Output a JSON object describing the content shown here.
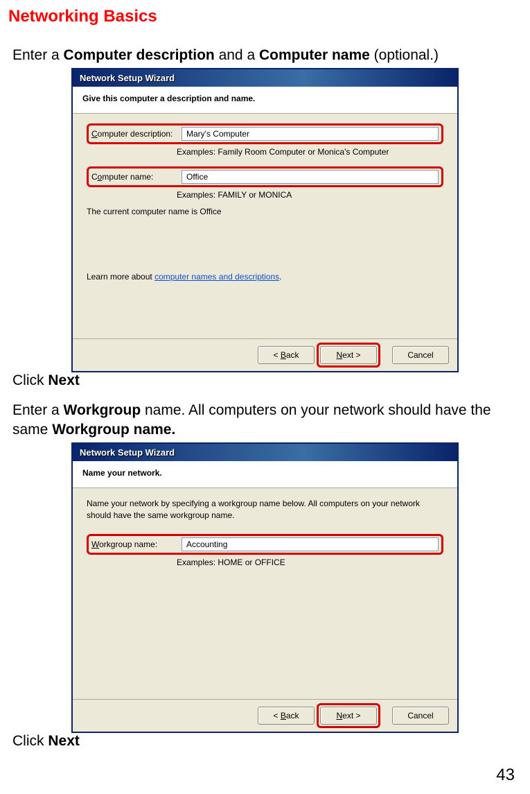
{
  "page": {
    "title": "Networking Basics",
    "page_number": "43"
  },
  "instr1": {
    "pre": "Enter a ",
    "b1": "Computer description",
    "mid": " and a ",
    "b2": "Computer name",
    "post": " (optional.)"
  },
  "wizard1": {
    "title": "Network Setup Wizard",
    "header": "Give this computer a description and name.",
    "desc_label_pre": "C",
    "desc_label_rest": "omputer description:",
    "desc_value": "Mary's Computer",
    "desc_hint": "Examples: Family Room Computer or Monica's Computer",
    "name_label_pre": "o",
    "name_label_prefix": "C",
    "name_label_rest": "mputer name:",
    "name_value": "Office",
    "name_hint": "Examples: FAMILY or MONICA",
    "current_pre": "The current computer name is   ",
    "current_val": "Office",
    "learn_pre": "Learn more about ",
    "learn_link": "computer names and descriptions",
    "btn_back": "< Back",
    "btn_next": "Next >",
    "btn_cancel": "Cancel"
  },
  "click1": {
    "pre": "Click ",
    "b": "Next"
  },
  "instr2": {
    "pre": "Enter a ",
    "b1": "Workgroup",
    "mid": " name.  All computers on your network should have the same ",
    "b2": "Workgroup name."
  },
  "wizard2": {
    "title": "Network Setup Wizard",
    "header": "Name your network.",
    "intro": "Name your network by specifying a workgroup name below. All computers on your network should have the same workgroup name.",
    "label_u": "W",
    "label_rest": "orkgroup name:",
    "value": "Accounting",
    "hint": "Examples: HOME or OFFICE",
    "btn_back": "< Back",
    "btn_next": "Next >",
    "btn_cancel": "Cancel"
  },
  "click2": {
    "pre": "Click ",
    "b": "Next"
  }
}
